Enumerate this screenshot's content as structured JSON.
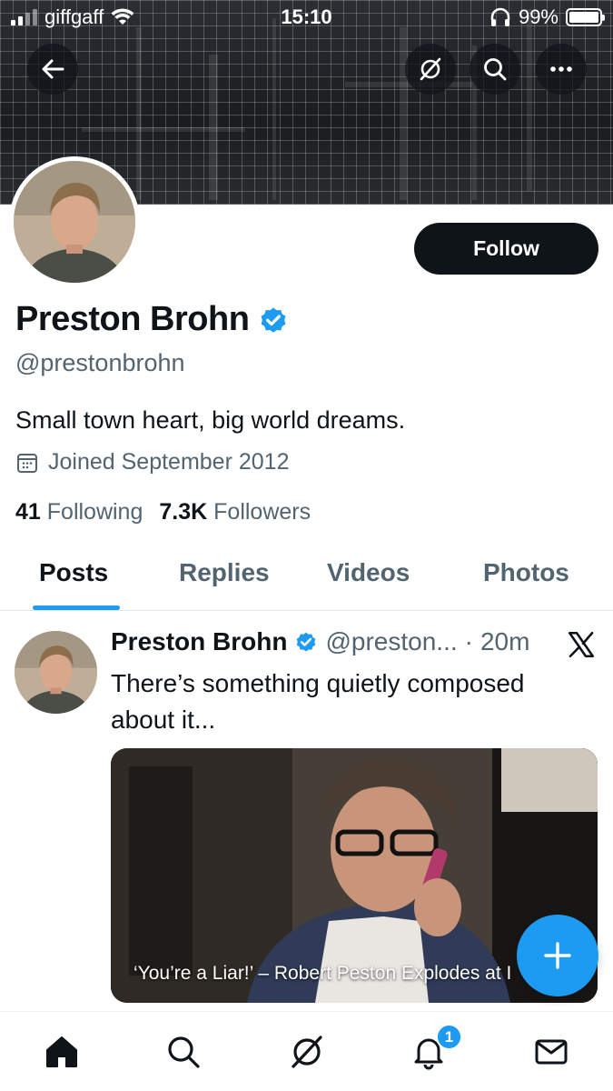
{
  "status_bar": {
    "carrier": "giffgaff",
    "time": "15:10",
    "battery": "99%",
    "battery_level": 0.99
  },
  "profile": {
    "name": "Preston Brohn",
    "handle": "@prestonbrohn",
    "verified": true,
    "bio": "Small town heart, big world dreams.",
    "joined": "Joined September 2012",
    "following_count": "41",
    "following_label": "Following",
    "followers_count": "7.3K",
    "followers_label": "Followers",
    "follow_label": "Follow"
  },
  "tabs": [
    {
      "label": "Posts",
      "active": true
    },
    {
      "label": "Replies",
      "active": false
    },
    {
      "label": "Videos",
      "active": false
    },
    {
      "label": "Photos",
      "active": false
    }
  ],
  "post": {
    "author": "Preston Brohn",
    "handle": "@preston...",
    "separator": "·",
    "time": "20m",
    "text": "There’s something quietly composed about it...",
    "media_caption": "‘You’re a Liar!’ – Robert Peston Explodes at I"
  },
  "notifications_badge": "1",
  "icons": {
    "back": "back-arrow-icon",
    "grok": "grok-icon",
    "search": "search-icon",
    "more": "more-icon",
    "calendar": "calendar-icon",
    "verified": "verified-badge-icon",
    "x_logo": "x-logo-icon",
    "compose": "plus-icon",
    "home": "home-icon",
    "notifications": "bell-icon",
    "messages": "mail-icon"
  },
  "colors": {
    "accent": "#1d9bf0",
    "text_primary": "#0f1419",
    "text_secondary": "#536471"
  }
}
